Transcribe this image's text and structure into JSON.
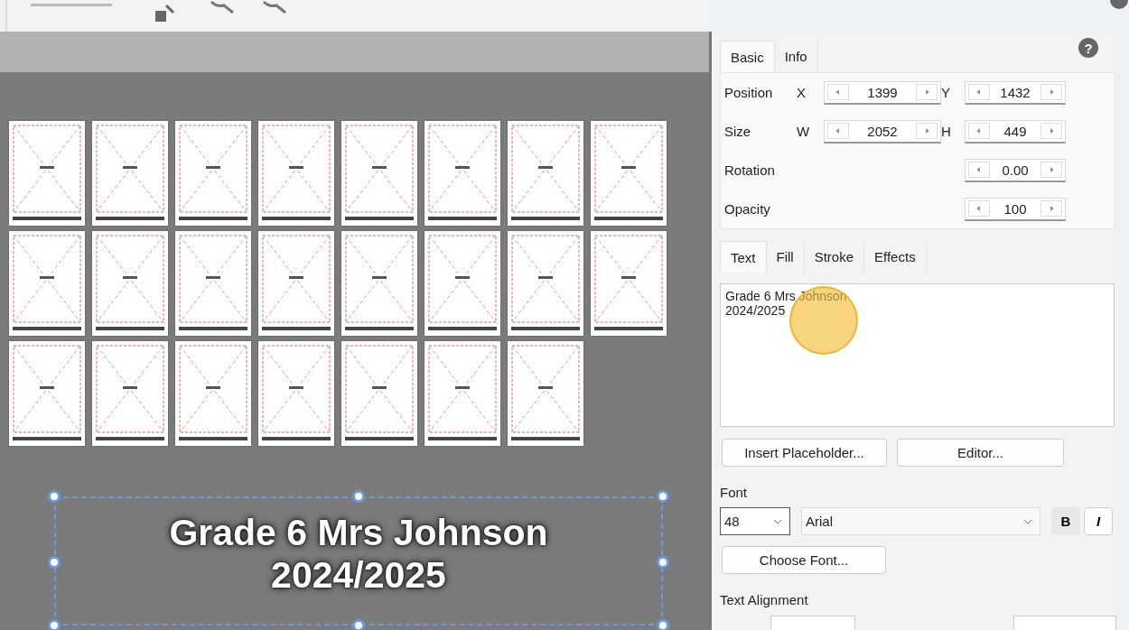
{
  "canvas_text": {
    "lines": [
      "Grade 6 Mrs Johnson",
      "2024/2025"
    ],
    "selected": true
  },
  "properties": {
    "tabs": [
      {
        "label": "Basic",
        "selected": true
      },
      {
        "label": "Info",
        "selected": false
      }
    ],
    "rows": [
      {
        "label": "Position",
        "fields": [
          {
            "axis": "X",
            "value": "1399"
          },
          {
            "axis": "Y",
            "value": "1432"
          }
        ]
      },
      {
        "label": "Size",
        "fields": [
          {
            "axis": "W",
            "value": "2052"
          },
          {
            "axis": "H",
            "value": "449"
          }
        ]
      },
      {
        "label": "Rotation",
        "fields": [
          {
            "value": "0.00"
          }
        ]
      },
      {
        "label": "Opacity",
        "fields": [
          {
            "value": "100"
          }
        ]
      }
    ]
  },
  "style_tabs": [
    {
      "label": "Text",
      "selected": true
    },
    {
      "label": "Fill",
      "selected": false
    },
    {
      "label": "Stroke",
      "selected": false
    },
    {
      "label": "Effects",
      "selected": false
    }
  ],
  "text_box": {
    "value": "Grade 6 Mrs Johnson\n2024/2025"
  },
  "text_buttons": [
    "Insert Placeholder...",
    "Editor..."
  ],
  "font": {
    "label": "Font",
    "size": "48",
    "family": "Arial",
    "bold_label": "B",
    "bold": true,
    "italic_label": "I",
    "italic": false,
    "choose_button": "Choose Font..."
  },
  "alignment_label": "Text Alignment",
  "help_label": "?"
}
